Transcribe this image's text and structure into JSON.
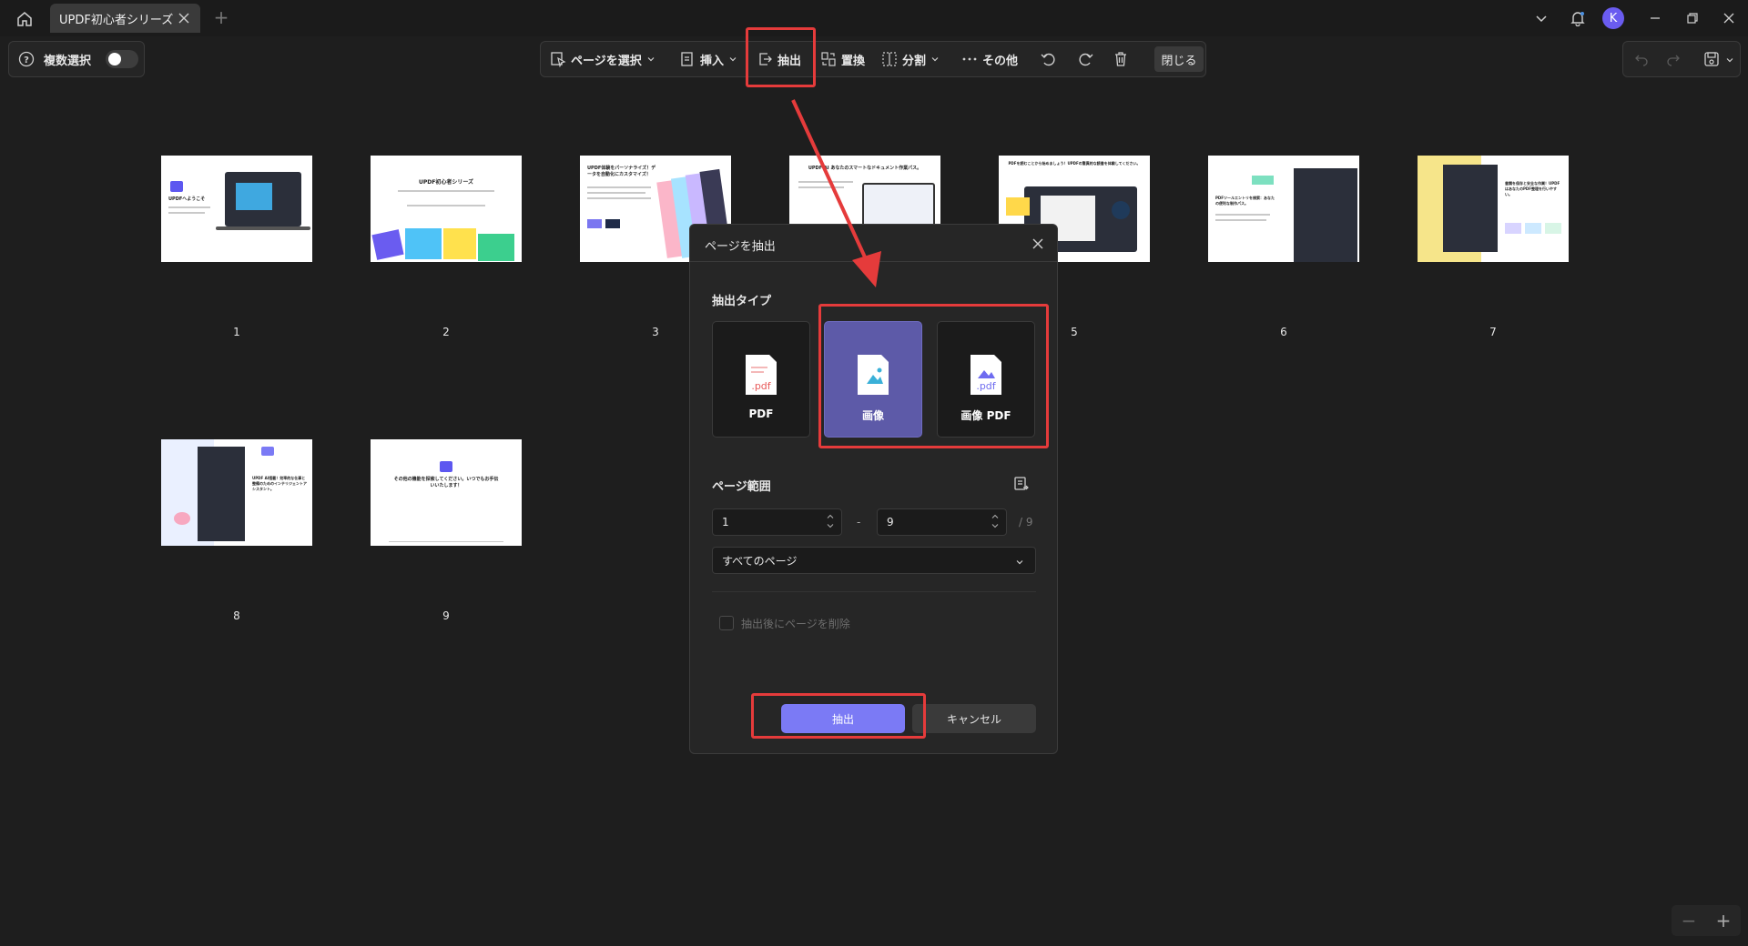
{
  "titlebar": {
    "tab_title": "UPDF初心者シリーズ",
    "avatar_letter": "K"
  },
  "left_panel": {
    "multi_select_label": "複数選択"
  },
  "toolbar": {
    "select_pages": "ページを選択",
    "insert": "挿入",
    "extract": "抽出",
    "replace": "置換",
    "split": "分割",
    "more": "その他",
    "close": "閉じる"
  },
  "pages": [
    {
      "number": "1",
      "text": "UPDFへようこそ"
    },
    {
      "number": "2",
      "text": "UPDF初心者シリーズ"
    },
    {
      "number": "3",
      "text": "UPDF体験をパーソナライズ！データを自動化にカスタマイズ！"
    },
    {
      "number": "4",
      "text": "UPDF AI あなたのスマートなドキュメント作業パス。"
    },
    {
      "number": "5",
      "text": "PDFを読むことから始めましょう！UPDFの驚異的な読書を体験してください。"
    },
    {
      "number": "6",
      "text": "PDFツールエントリを検索：あなたの便利な制作パス。"
    },
    {
      "number": "7",
      "text": "書類を保存と安全な作業！UPDFはあなたのPDF整理を行いやすい。"
    },
    {
      "number": "8",
      "text": "UPDF AI搭載！効率的な仕事と整備のためのインテリジェントアシスタント。"
    },
    {
      "number": "9",
      "text": "その他の機能を探索してください。いつでもお手伝いいたします！"
    }
  ],
  "dialog": {
    "title": "ページを抽出",
    "extract_type_label": "抽出タイプ",
    "types": [
      {
        "label": "PDF",
        "selected": false
      },
      {
        "label": "画像",
        "selected": true
      },
      {
        "label": "画像 PDF",
        "selected": false
      }
    ],
    "page_range_label": "ページ範囲",
    "range_from": "1",
    "range_sep": "-",
    "range_to": "9",
    "total_pages": "/ 9",
    "range_option": "すべてのページ",
    "delete_after_label": "抽出後にページを削除",
    "delete_after_checked": false,
    "extract_button": "抽出",
    "cancel_button": "キャンセル"
  },
  "zoom": {
    "minus": "−",
    "plus": "+"
  },
  "colors": {
    "accent": "#7b7af5",
    "selected_card": "#5d5aa8",
    "annotation_red": "#e53b3b",
    "background": "#1e1e1e"
  }
}
